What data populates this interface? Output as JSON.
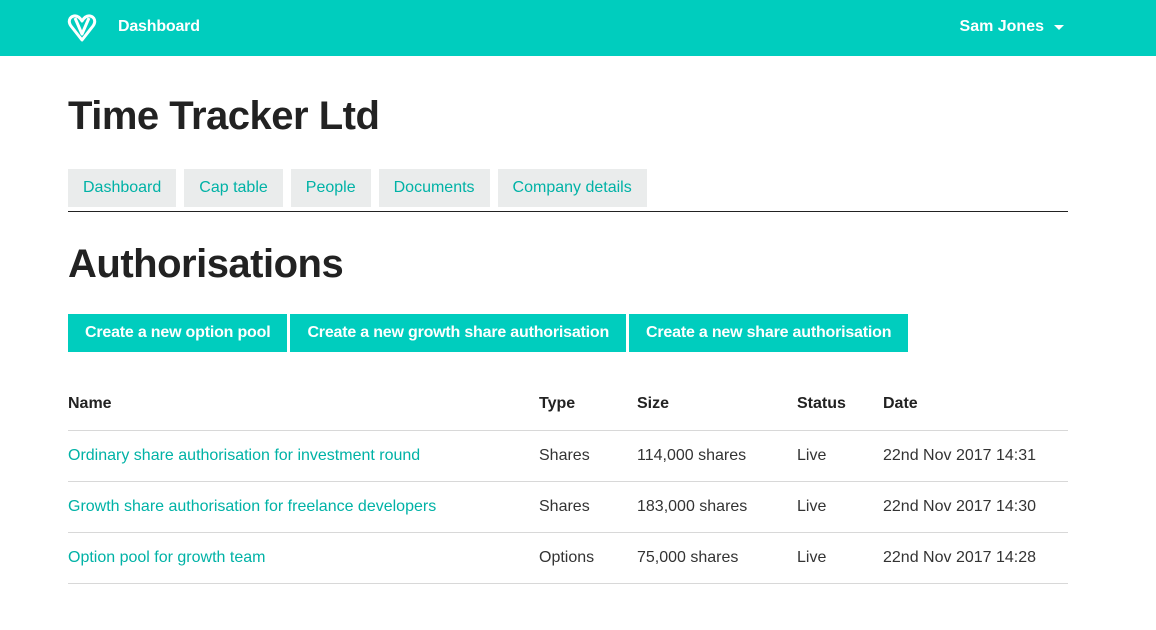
{
  "header": {
    "logo_icon": "heart-v-logo-icon",
    "brand_label": "Dashboard",
    "user_name": "Sam Jones",
    "accent_color": "#00cdbe"
  },
  "company": {
    "title": "Time Tracker Ltd"
  },
  "tabs": [
    {
      "label": "Dashboard"
    },
    {
      "label": "Cap table"
    },
    {
      "label": "People"
    },
    {
      "label": "Documents"
    },
    {
      "label": "Company details"
    }
  ],
  "section": {
    "title": "Authorisations"
  },
  "actions": {
    "option_pool": "Create a new option pool",
    "growth_share": "Create a new growth share authorisation",
    "share": "Create a new share authorisation"
  },
  "table": {
    "headers": {
      "name": "Name",
      "type": "Type",
      "size": "Size",
      "status": "Status",
      "date": "Date"
    },
    "rows": [
      {
        "name": "Ordinary share authorisation for investment round",
        "type": "Shares",
        "size": "114,000 shares",
        "status": "Live",
        "date": "22nd Nov 2017 14:31"
      },
      {
        "name": "Growth share authorisation for freelance developers",
        "type": "Shares",
        "size": "183,000 shares",
        "status": "Live",
        "date": "22nd Nov 2017 14:30"
      },
      {
        "name": "Option pool for growth team",
        "type": "Options",
        "size": "75,000 shares",
        "status": "Live",
        "date": "22nd Nov 2017 14:28"
      }
    ]
  }
}
